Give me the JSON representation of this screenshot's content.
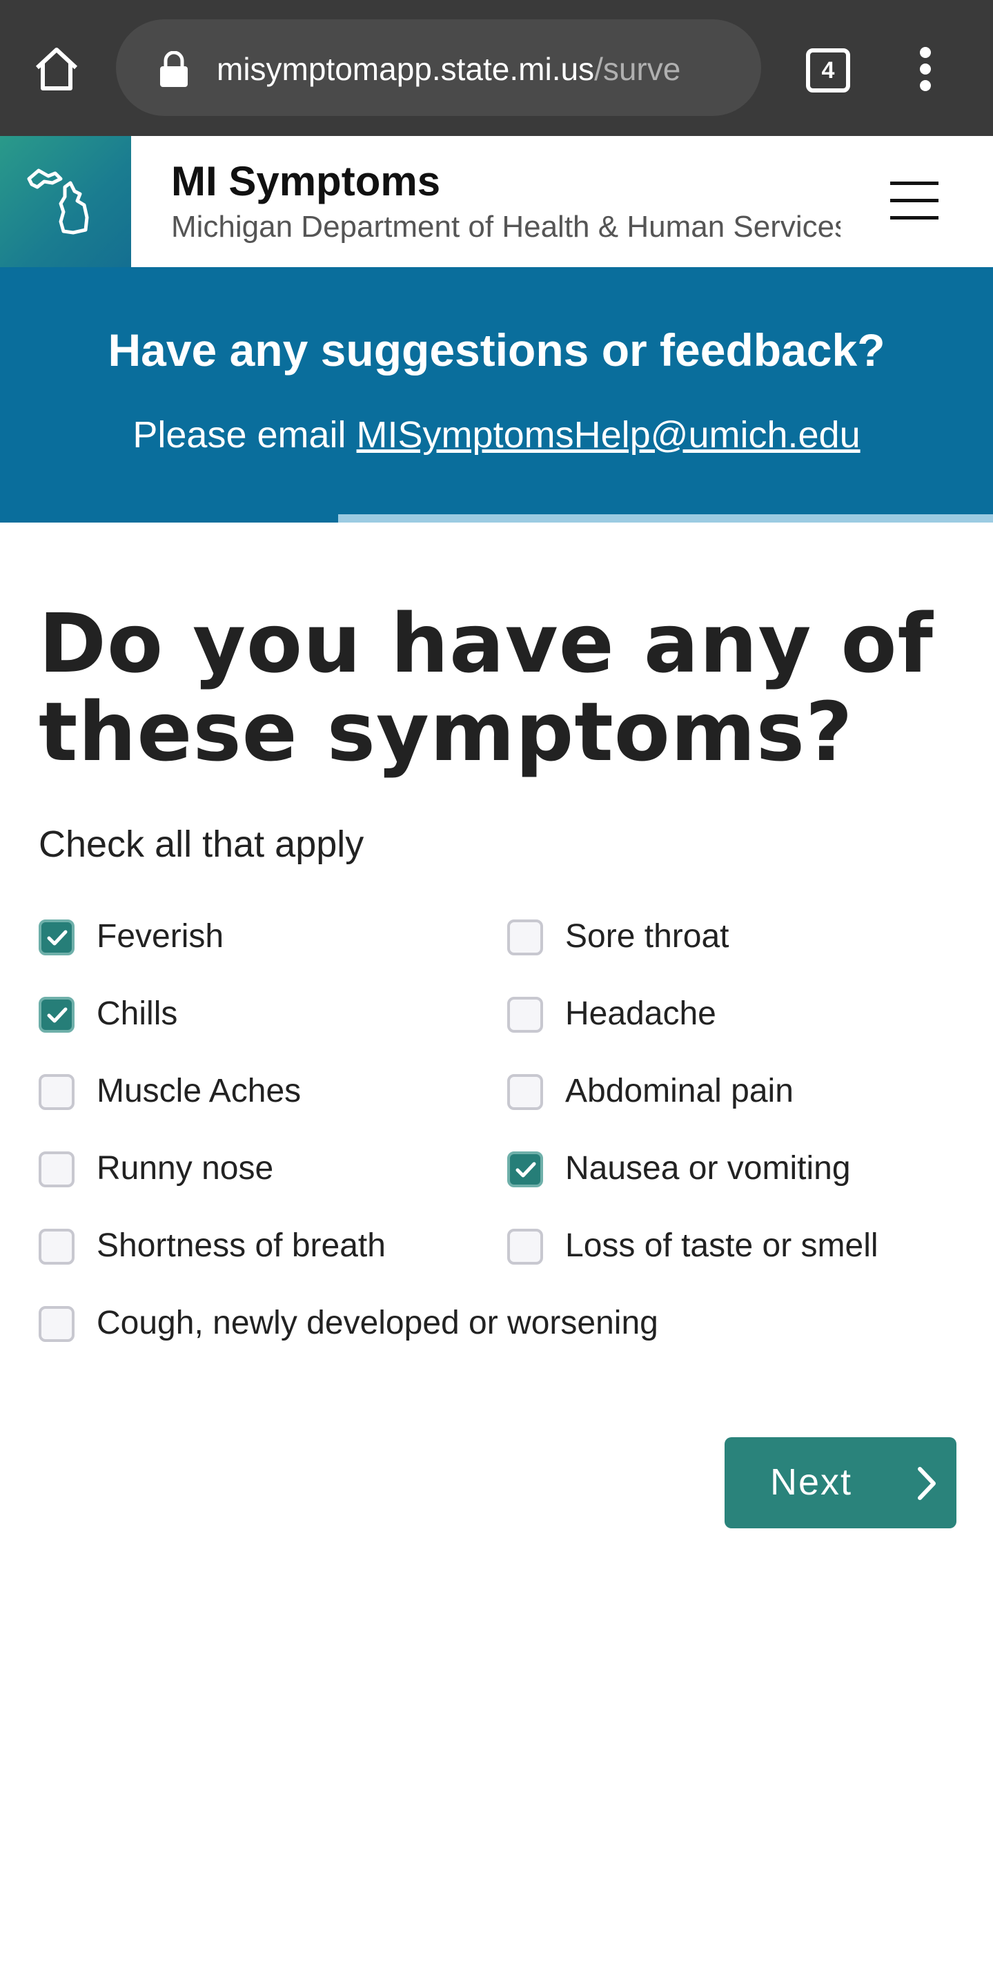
{
  "browser": {
    "url_host": "misymptomapp.state.mi.us",
    "url_path": "/surve",
    "tab_count": "4"
  },
  "header": {
    "title": "MI Symptoms",
    "subtitle": "Michigan Department of Health & Human Services"
  },
  "banner": {
    "headline": "Have any suggestions or feedback?",
    "email_prefix": "Please email ",
    "email": "MISymptomsHelp@umich.edu"
  },
  "main": {
    "question": "Do you have any of these symptoms?",
    "hint": "Check all that apply",
    "options": [
      {
        "label": "Feverish",
        "checked": true
      },
      {
        "label": "Sore throat",
        "checked": false
      },
      {
        "label": "Chills",
        "checked": true
      },
      {
        "label": "Headache",
        "checked": false
      },
      {
        "label": "Muscle Aches",
        "checked": false
      },
      {
        "label": "Abdominal pain",
        "checked": false
      },
      {
        "label": "Runny nose",
        "checked": false
      },
      {
        "label": "Nausea or vomiting",
        "checked": true
      },
      {
        "label": "Shortness of breath",
        "checked": false
      },
      {
        "label": "Loss of taste or smell",
        "checked": false
      },
      {
        "label": "Cough, newly developed or worsening",
        "checked": false
      }
    ],
    "next_label": "Next"
  },
  "colors": {
    "brand_teal": "#2a837b",
    "banner_blue": "#0a6e9c",
    "chrome_dark": "#3a3a3a"
  }
}
